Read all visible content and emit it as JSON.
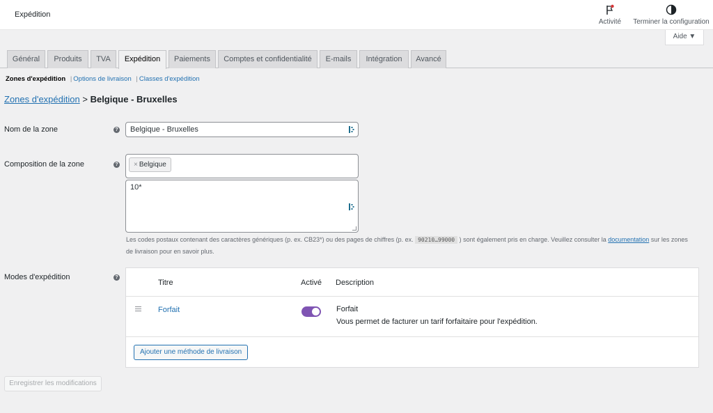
{
  "header": {
    "title": "Expédition",
    "activity_label": "Activité",
    "finish_label": "Terminer la configuration",
    "help_label": "Aide ▼",
    "icons": {
      "activity": "flag-icon",
      "finish": "half-circle-icon"
    }
  },
  "tabs": [
    {
      "label": "Général"
    },
    {
      "label": "Produits"
    },
    {
      "label": "TVA"
    },
    {
      "label": "Expédition",
      "active": true
    },
    {
      "label": "Paiements"
    },
    {
      "label": "Comptes et confidentialité"
    },
    {
      "label": "E-mails"
    },
    {
      "label": "Intégration"
    },
    {
      "label": "Avancé"
    }
  ],
  "subnav": {
    "current": "Zones d'expédition",
    "links": [
      "Options de livraison",
      "Classes d'expédition"
    ]
  },
  "breadcrumb": {
    "link": "Zones d'expédition",
    "separator": ">",
    "current": "Belgique - Bruxelles"
  },
  "form": {
    "zone_name": {
      "label": "Nom de la zone",
      "value": "Belgique - Bruxelles"
    },
    "composition": {
      "label": "Composition de la zone",
      "chip_remove": "×",
      "chip": "Belgique",
      "postcodes": "10*"
    },
    "hint": {
      "text_before": "Les codes postaux contenant des caractères génériques (p. ex. CB23*) ou des pages de chiffres (p. ex.",
      "code": "90210…99000",
      "text_middle": ") sont également pris en charge. Veuillez consulter la",
      "link": "documentation",
      "text_after": "sur les zones de livraison pour en savoir plus."
    },
    "methods": {
      "label": "Modes d'expédition",
      "columns": [
        "Titre",
        "Activé",
        "Description"
      ],
      "rows": [
        {
          "title": "Forfait",
          "enabled": true,
          "desc_title": "Forfait",
          "description": "Vous permet de facturer un tarif forfaitaire pour l'expédition."
        }
      ],
      "add_button": "Ajouter une méthode de livraison"
    },
    "help_icon_glyph": "?"
  },
  "save_button": "Enregistrer les modifications",
  "colors": {
    "accent": "#2271b1",
    "toggle": "#7f54b3",
    "background": "#f0f0f1"
  }
}
